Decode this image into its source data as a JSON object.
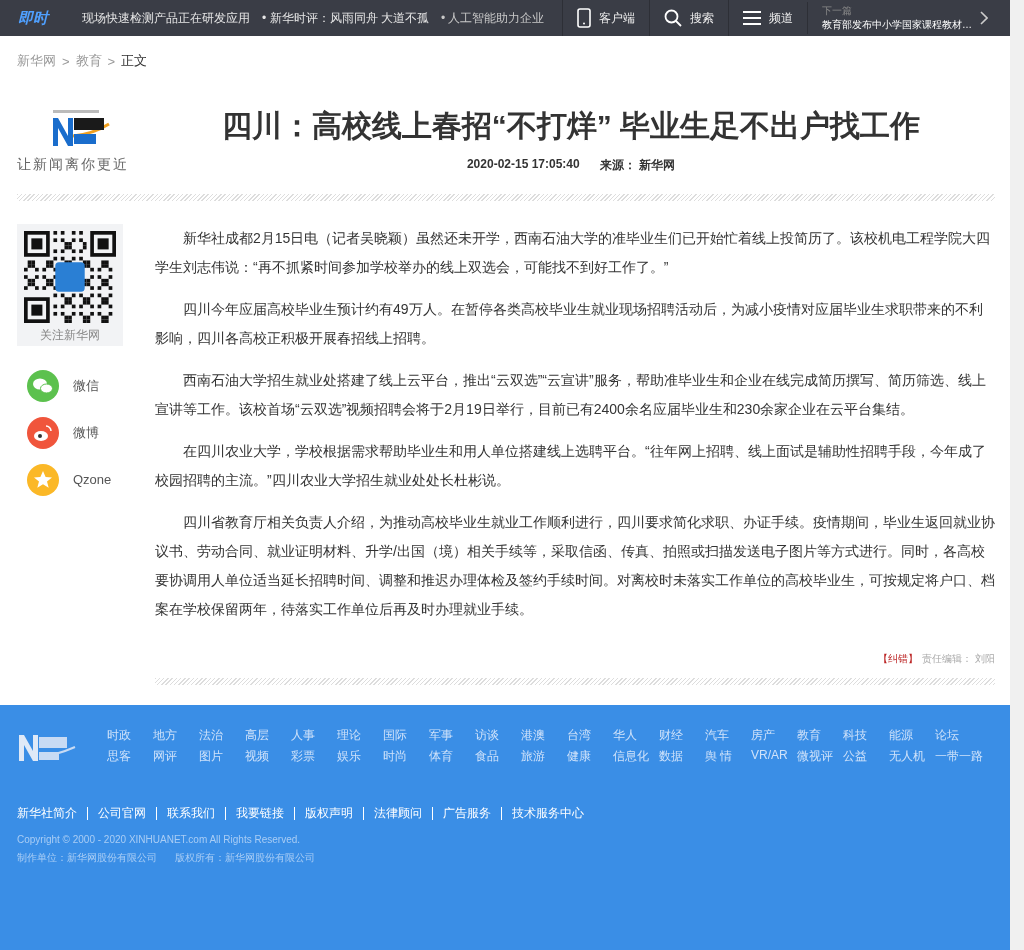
{
  "top_bar": {
    "logo": "即时",
    "ticker": [
      "现场快速检测产品正在研发应用",
      "• 新华时评：风雨同舟 大道不孤",
      "• 人工智能助力企业"
    ],
    "actions": [
      {
        "kind": "phone",
        "label": "客户端"
      },
      {
        "kind": "search",
        "label": "搜索"
      },
      {
        "kind": "menu",
        "label": "频道"
      }
    ],
    "next": {
      "label": "下一篇",
      "title": "教育部发布中小学国家课程教材…"
    }
  },
  "breadcrumb": [
    "新华网",
    "教育",
    "正文"
  ],
  "breadcrumb_separator": ">",
  "header": {
    "logo_slogan": "让新闻离你更近",
    "title": "四川：高校线上春招“不打烊” 毕业生足不出户找工作",
    "date": "2020-02-15 17:05:40",
    "source": "来源： 新华网"
  },
  "sidebar": {
    "qr_caption": "关注新华网",
    "share": [
      {
        "kind": "wechat",
        "label": "微信",
        "color": "#5cc14e"
      },
      {
        "kind": "weibo",
        "label": "微博",
        "color": "#f0553c"
      },
      {
        "kind": "qzone",
        "label": "Qzone",
        "color": "#fbb827"
      }
    ]
  },
  "article": {
    "paragraphs": [
      "新华社成都2月15日电（记者吴晓颖）虽然还未开学，西南石油大学的准毕业生们已开始忙着线上投简历了。该校机电工程学院大四学生刘志伟说：“再不抓紧时间参加学校举办的线上双选会，可能找不到好工作了。”",
      "四川今年应届高校毕业生预计约有49万人。在暂停各类高校毕业生就业现场招聘活动后，为减小疫情对应届毕业生求职带来的不利影响，四川各高校正积极开展春招线上招聘。",
      "西南石油大学招生就业处搭建了线上云平台，推出“云双选”“云宣讲”服务，帮助准毕业生和企业在线完成简历撰写、简历筛选、线上宣讲等工作。该校首场“云双选”视频招聘会将于2月19日举行，目前已有2400余名应届毕业生和230余家企业在云平台集结。",
      "在四川农业大学，学校根据需求帮助毕业生和用人单位搭建线上选聘平台。“往年网上招聘、线上面试是辅助性招聘手段，今年成了校园招聘的主流。”四川农业大学招生就业处处长杜彬说。",
      "四川省教育厅相关负责人介绍，为推动高校毕业生就业工作顺利进行，四川要求简化求职、办证手续。疫情期间，毕业生返回就业协议书、劳动合同、就业证明材料、升学/出国（境）相关手续等，采取信函、传真、拍照或扫描发送电子图片等方式进行。同时，各高校要协调用人单位适当延长招聘时间、调整和推迟办理体检及签约手续时间。对离校时未落实工作单位的高校毕业生，可按规定将户口、档案在学校保留两年，待落实工作单位后再及时办理就业手续。"
    ],
    "correction": "【纠错】",
    "editor": "责任编辑： 刘阳"
  },
  "footer": {
    "nav_rows": [
      [
        "时政",
        "地方",
        "法治",
        "高层",
        "人事",
        "理论",
        "国际",
        "军事",
        "访谈",
        "港澳",
        "台湾",
        "华人",
        "财经",
        "汽车",
        "房产",
        "教育",
        "科技",
        "能源",
        "论坛"
      ],
      [
        "思客",
        "网评",
        "图片",
        "视频",
        "彩票",
        "娱乐",
        "时尚",
        "体育",
        "食品",
        "旅游",
        "健康",
        "信息化",
        "数据",
        "舆 情",
        "VR/AR",
        "微视评",
        "公益",
        "无人机",
        "一带一路"
      ]
    ],
    "links": [
      "新华社简介",
      "公司官网",
      "联系我们",
      "我要链接",
      "版权声明",
      "法律顾问",
      "广告服务",
      "技术服务中心"
    ],
    "copyright": "Copyright © 2000 - 2020 XINHUANET.com   All Rights Reserved.",
    "producer": "制作单位：新华网股份有限公司",
    "owner": "版权所有：新华网股份有限公司"
  }
}
